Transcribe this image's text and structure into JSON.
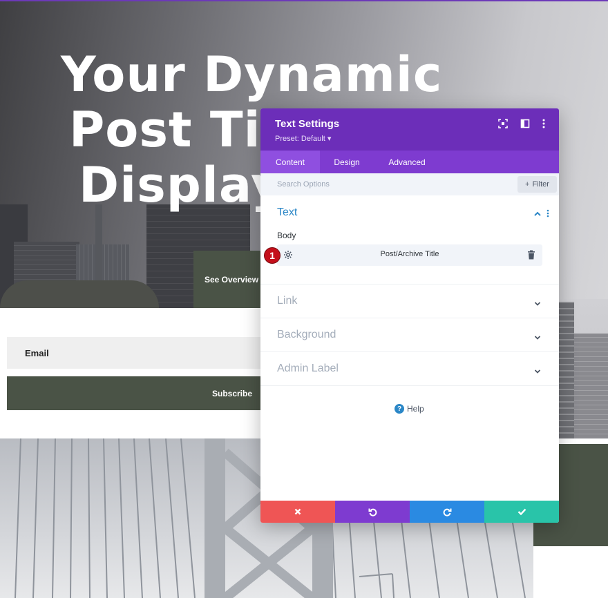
{
  "hero": {
    "title_line1": "Your Dynamic",
    "title_line2": "Post Title",
    "title_line3": "Display",
    "overview_button": "See Overview"
  },
  "form": {
    "email_placeholder": "Email",
    "subscribe_label": "Subscribe"
  },
  "panel": {
    "title": "Text Settings",
    "preset": "Preset: Default ▾",
    "tabs": [
      "Content",
      "Design",
      "Advanced"
    ],
    "active_tab": "Content",
    "search_placeholder": "Search Options",
    "filter_label": "Filter",
    "text_section": {
      "title": "Text",
      "body_label": "Body",
      "dynamic_value": "Post/Archive Title",
      "marker": "1"
    },
    "collapsed_sections": [
      "Link",
      "Background",
      "Admin Label"
    ],
    "help_label": "Help",
    "colors": {
      "header": "#6c2eb9",
      "tabs": "#7e3bd0",
      "section_title": "#2b87c7",
      "cancel": "#ef5555",
      "undo": "#7e3bd0",
      "redo": "#2a8ae2",
      "save": "#29c4a9"
    }
  }
}
